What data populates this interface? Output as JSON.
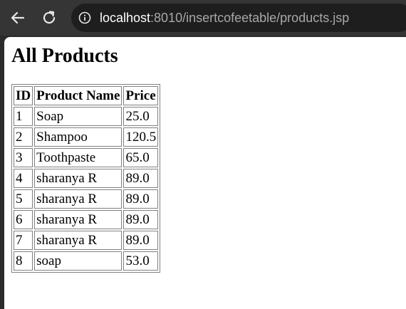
{
  "browser": {
    "url_host": "localhost",
    "url_rest": ":8010/insertcofeetable/products.jsp",
    "back_icon": "arrow-left-icon",
    "reload_icon": "reload-icon",
    "site_info_icon": "info-icon"
  },
  "page": {
    "title": "All Products",
    "table": {
      "headers": {
        "id": "ID",
        "name": "Product Name",
        "price": "Price"
      },
      "rows": [
        {
          "id": "1",
          "name": "Soap",
          "price": "25.0"
        },
        {
          "id": "2",
          "name": "Shampoo",
          "price": "120.5"
        },
        {
          "id": "3",
          "name": "Toothpaste",
          "price": "65.0"
        },
        {
          "id": "4",
          "name": "sharanya R",
          "price": "89.0"
        },
        {
          "id": "5",
          "name": "sharanya R",
          "price": "89.0"
        },
        {
          "id": "6",
          "name": "sharanya R",
          "price": "89.0"
        },
        {
          "id": "7",
          "name": "sharanya R",
          "price": "89.0"
        },
        {
          "id": "8",
          "name": "soap",
          "price": "53.0"
        }
      ]
    }
  },
  "colors": {
    "toolbar_bg": "#353535",
    "address_bar_bg": "#1e1e1e",
    "url_muted": "#a8a8a8",
    "url_host": "#ffffff",
    "table_border": "#808080"
  }
}
